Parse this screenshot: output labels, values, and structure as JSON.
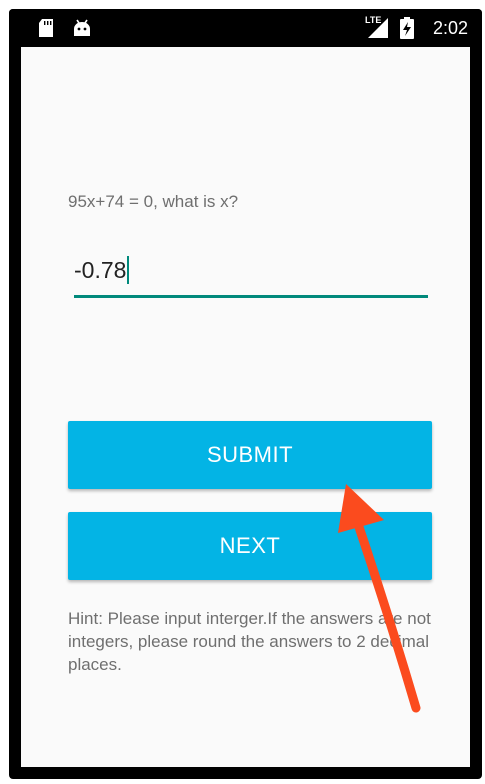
{
  "status_bar": {
    "time": "2:02",
    "network_label": "LTE",
    "icons": [
      "sd-card-icon",
      "android-icon",
      "signal-icon",
      "battery-charging-icon"
    ]
  },
  "quiz": {
    "question": "95x+74 = 0, what is x?",
    "answer_value": "-0.78",
    "submit_label": "SUBMIT",
    "next_label": "NEXT",
    "hint": "Hint: Please input interger.If the answers are not integers, please round the answers to 2 decimal places."
  },
  "colors": {
    "accent_teal": "#00897b",
    "button_blue": "#03b4e5",
    "annotation_arrow": "#fb4b1e"
  }
}
